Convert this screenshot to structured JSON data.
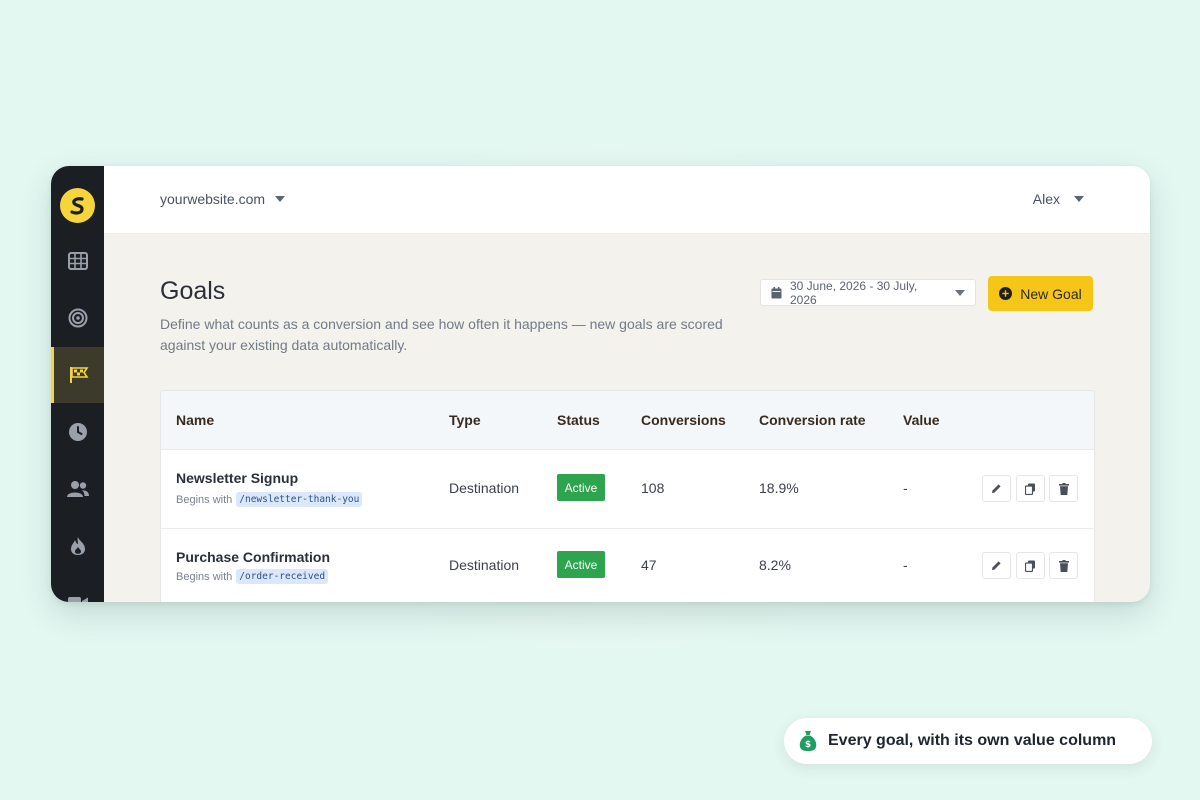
{
  "header": {
    "site": "yourwebsite.com",
    "user": "Alex"
  },
  "sidebar": {
    "items": [
      {
        "icon": "grid-icon",
        "active": false
      },
      {
        "icon": "target-icon",
        "active": false
      },
      {
        "icon": "flag-icon",
        "active": true
      },
      {
        "icon": "clock-icon",
        "active": false
      },
      {
        "icon": "users-icon",
        "active": false
      },
      {
        "icon": "fire-icon",
        "active": false
      },
      {
        "icon": "video-icon",
        "active": false
      }
    ]
  },
  "page": {
    "title": "Goals",
    "description": "Define what counts as a conversion and see how often it happens — new goals are scored against your existing data automatically.",
    "date_range": "30 June, 2026 - 30 July, 2026",
    "new_goal_label": "New Goal"
  },
  "table": {
    "columns": [
      "Name",
      "Type",
      "Status",
      "Conversions",
      "Conversion rate",
      "Value"
    ],
    "rows": [
      {
        "name": "Newsletter Signup",
        "rule_prefix": "Begins with",
        "rule_value": "/newsletter-thank-you",
        "type": "Destination",
        "status": "Active",
        "conversions": "108",
        "conversion_rate": "18.9%",
        "value": "-"
      },
      {
        "name": "Purchase Confirmation",
        "rule_prefix": "Begins with",
        "rule_value": "/order-received",
        "type": "Destination",
        "status": "Active",
        "conversions": "47",
        "conversion_rate": "8.2%",
        "value": "-"
      }
    ]
  },
  "callout": {
    "text": "Every goal, with its own value column",
    "icon": "money-bag-icon"
  },
  "colors": {
    "accent": "#f5c518",
    "status_active": "#2ea44f",
    "sidebar_bg": "#1b1e22",
    "page_bg": "#e4f8f2"
  }
}
